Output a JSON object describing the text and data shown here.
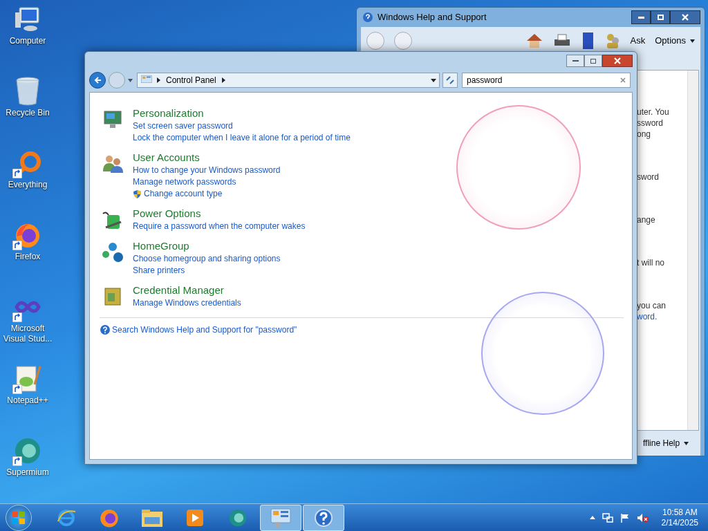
{
  "desktop_icons": [
    {
      "kind": "computer",
      "label": "Computer",
      "shortcut": false
    },
    {
      "kind": "recycle",
      "label": "Recycle Bin",
      "shortcut": false
    },
    {
      "kind": "everything",
      "label": "Everything",
      "shortcut": true
    },
    {
      "kind": "firefox",
      "label": "Firefox",
      "shortcut": true
    },
    {
      "kind": "vs",
      "label": "Microsoft Visual Stud...",
      "shortcut": true
    },
    {
      "kind": "notepad",
      "label": "Notepad++",
      "shortcut": true
    },
    {
      "kind": "supermium",
      "label": "Supermium",
      "shortcut": true
    }
  ],
  "help_window": {
    "title": "Windows Help and Support",
    "toolbar": [
      "Ask",
      "Options"
    ],
    "paragraphs": [
      [
        {
          "text": "uter. You",
          "link": false
        },
        {
          "text": "ssword",
          "link": false
        },
        {
          "text": "ong",
          "link": false
        }
      ],
      [
        {
          "text": "sword",
          "link": false
        }
      ],
      [
        {
          "text": "ange",
          "link": false
        }
      ],
      [
        {
          "text": "t will no",
          "link": false
        }
      ],
      [
        {
          "text": "you can",
          "link": false
        },
        {
          "text": "word.",
          "link": true
        }
      ]
    ],
    "footer": "ffline Help"
  },
  "control_panel": {
    "breadcrumb": [
      "Control Panel"
    ],
    "search": "password",
    "groups": [
      {
        "kind": "personalization",
        "title": "Personalization",
        "links": [
          {
            "text": "Set screen saver password",
            "shield": false
          },
          {
            "text": "Lock the computer when I leave it alone for a period of time",
            "shield": false
          }
        ]
      },
      {
        "kind": "users",
        "title": "User Accounts",
        "links": [
          {
            "text": "How to change your Windows password",
            "shield": false
          },
          {
            "text": "Manage network passwords",
            "shield": false
          },
          {
            "text": "Change account type",
            "shield": true
          }
        ]
      },
      {
        "kind": "power",
        "title": "Power Options",
        "links": [
          {
            "text": "Require a password when the computer wakes",
            "shield": false
          }
        ]
      },
      {
        "kind": "homegroup",
        "title": "HomeGroup",
        "links": [
          {
            "text": "Choose homegroup and sharing options",
            "shield": false
          },
          {
            "text": "Share printers",
            "shield": false
          }
        ]
      },
      {
        "kind": "credential",
        "title": "Credential Manager",
        "links": [
          {
            "text": "Manage Windows credentials",
            "shield": false
          }
        ]
      }
    ],
    "help_link": "Search Windows Help and Support for \"password\""
  },
  "taskbar": {
    "items": [
      {
        "kind": "ie",
        "active": false
      },
      {
        "kind": "firefox",
        "active": false
      },
      {
        "kind": "explorer",
        "active": false
      },
      {
        "kind": "media",
        "active": false
      },
      {
        "kind": "supermium",
        "active": false
      },
      {
        "kind": "controlpanel",
        "active": true
      },
      {
        "kind": "help",
        "active": true
      }
    ],
    "clock": {
      "time": "10:58 AM",
      "date": "2/14/2025"
    }
  }
}
